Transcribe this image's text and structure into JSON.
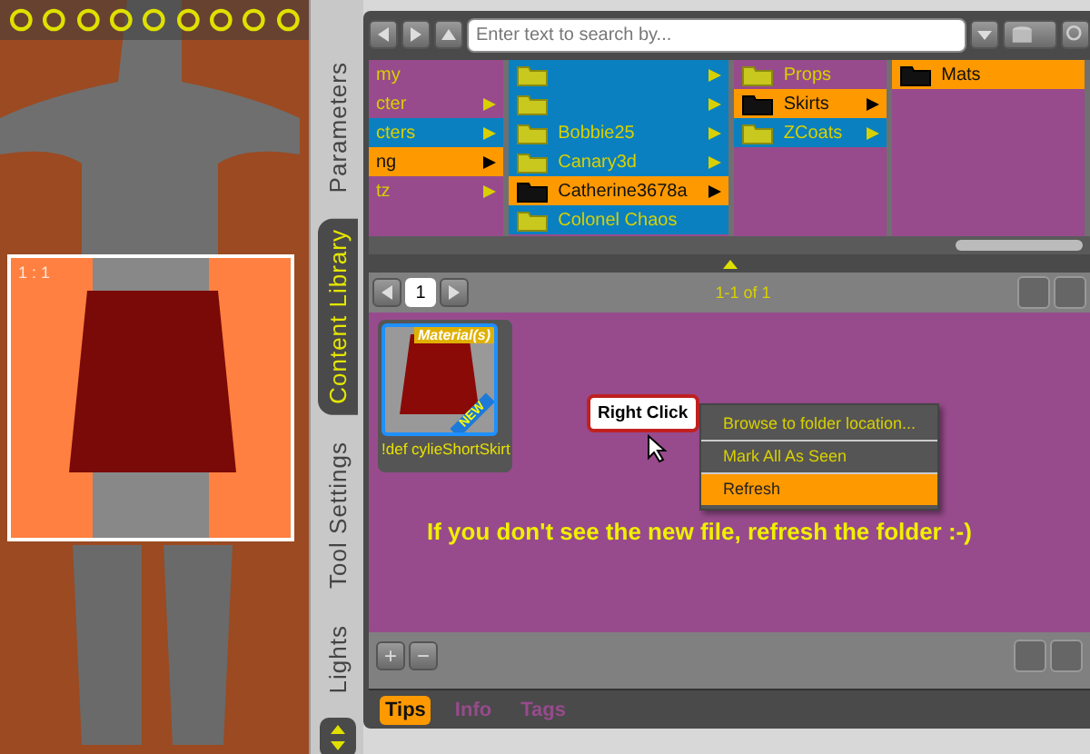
{
  "viewport": {
    "label": "1 : 1"
  },
  "side_tabs": [
    {
      "label": "Parameters",
      "selected": false
    },
    {
      "label": "Content Library",
      "selected": true
    },
    {
      "label": "Tool Settings",
      "selected": false
    },
    {
      "label": "Lights",
      "selected": false
    }
  ],
  "search": {
    "placeholder": "Enter text to search by..."
  },
  "browser_columns": [
    {
      "items": [
        {
          "label": "my",
          "color": "#974b8c",
          "selected": false,
          "has_children": false
        },
        {
          "label": "cter",
          "color": "#974b8c",
          "selected": false,
          "has_children": true
        },
        {
          "label": "cters",
          "color": "#0a80c0",
          "selected": false,
          "has_children": true
        },
        {
          "label": "ng",
          "selected": true,
          "has_children": true
        },
        {
          "label": "tz",
          "color": "#974b8c",
          "selected": false,
          "has_children": true
        }
      ]
    },
    {
      "items": [
        {
          "color": "#0a80c0",
          "selected": false,
          "has_children": true
        },
        {
          "color": "#0a80c0",
          "selected": false,
          "has_children": true
        },
        {
          "label": "Bobbie25",
          "color": "#0a80c0",
          "selected": false,
          "has_children": true
        },
        {
          "label": "Canary3d",
          "color": "#0a80c0",
          "selected": false,
          "has_children": true
        },
        {
          "label": "Catherine3678a",
          "selected": true,
          "has_children": true
        },
        {
          "label": "Colonel Chaos",
          "color": "#0a80c0",
          "selected": false,
          "has_children": false
        }
      ]
    },
    {
      "items": [
        {
          "label": "Props",
          "color": "#974b8c",
          "selected": false,
          "has_children": false
        },
        {
          "label": "Skirts",
          "selected": true,
          "has_children": true
        },
        {
          "label": "ZCoats",
          "color": "#0a80c0",
          "selected": false,
          "has_children": true
        }
      ]
    },
    {
      "items": [
        {
          "label": "Mats",
          "selected": true,
          "has_children": false
        }
      ]
    }
  ],
  "pager": {
    "page": "1",
    "summary": "1-1 of 1"
  },
  "asset": {
    "name": "!def cylieShortSkirt",
    "badge": "Material(s)",
    "new_label": "NEW"
  },
  "callout": "Right Click",
  "context_menu": [
    {
      "label": "Browse to folder location...",
      "selected": false
    },
    {
      "label": "Mark All As Seen",
      "selected": false
    },
    {
      "label": "Refresh",
      "selected": true
    }
  ],
  "tip_text": "If you don't see the new file, refresh the folder :-)",
  "footer_buttons": [
    "+",
    "−"
  ],
  "bottom_tabs": [
    {
      "label": "Tips",
      "selected": true
    },
    {
      "label": "Info",
      "selected": false
    },
    {
      "label": "Tags",
      "selected": false
    }
  ]
}
